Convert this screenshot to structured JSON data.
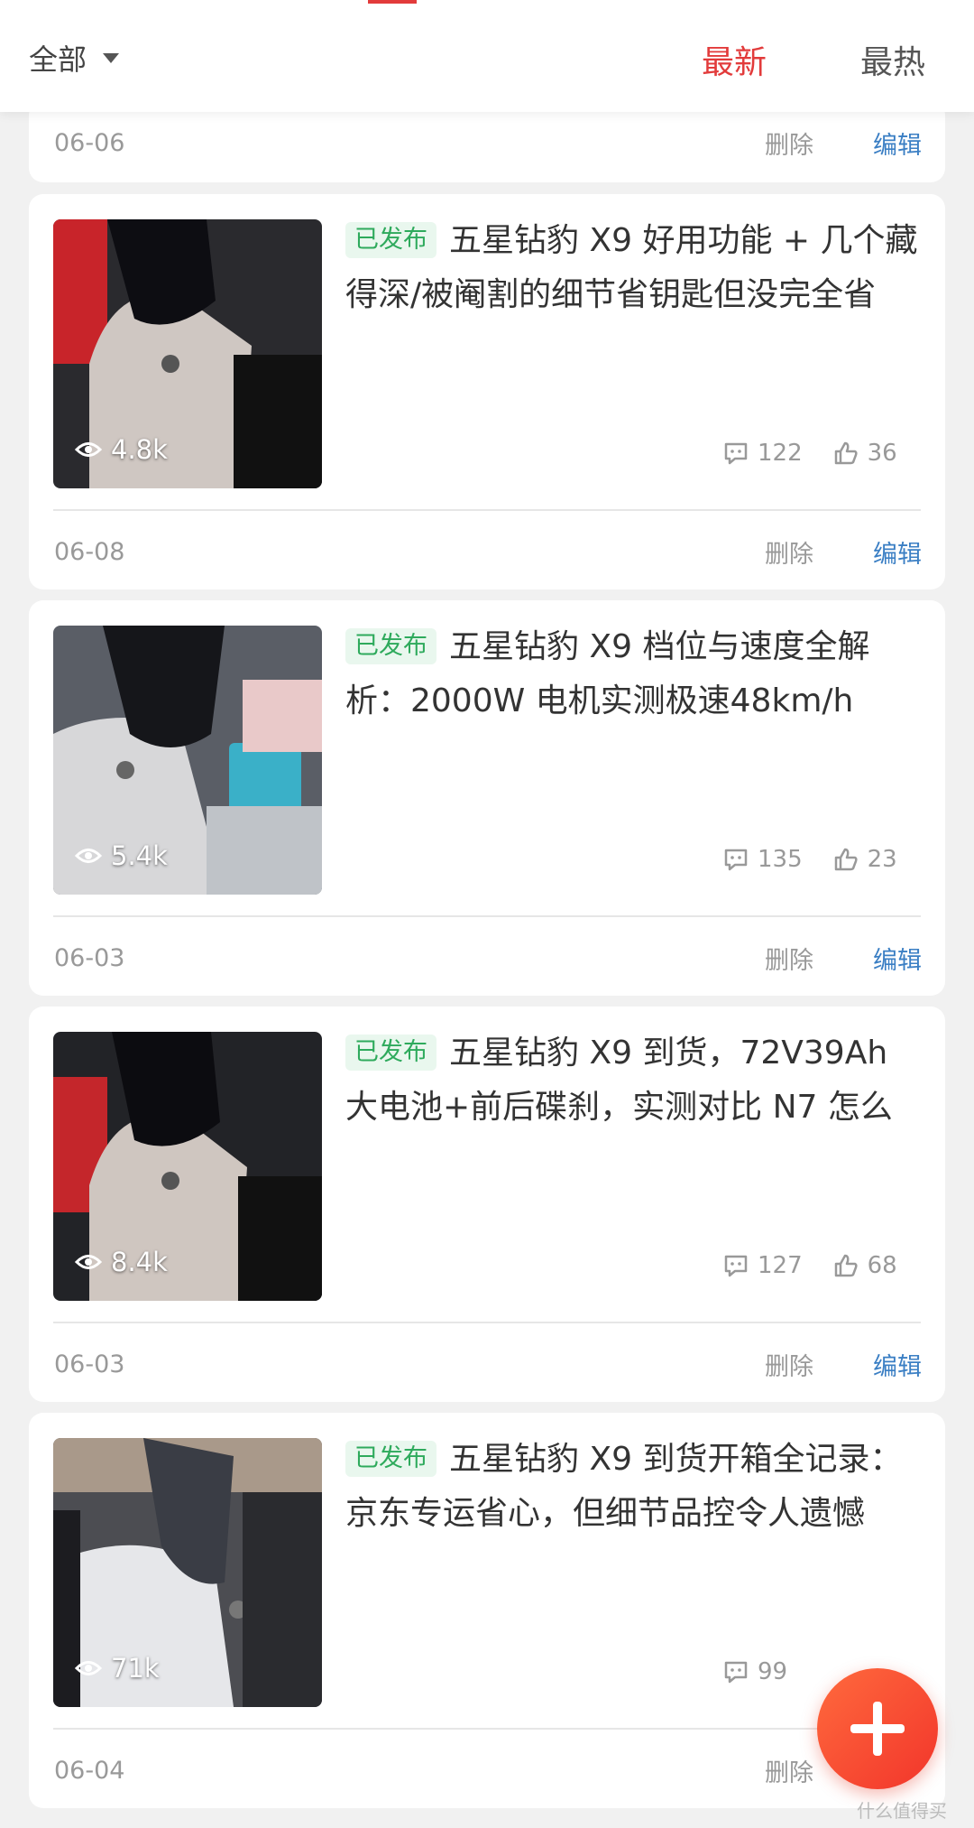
{
  "header": {
    "filter_label": "全部",
    "sort_options": [
      "最新",
      "最热"
    ],
    "active_sort": "最新"
  },
  "row_actions": {
    "delete": "删除",
    "edit": "编辑"
  },
  "top_card": {
    "date": "06-06"
  },
  "articles": [
    {
      "status": "已发布",
      "title": "五星钻豹 X9 好用功能 + 几个藏得深/被阉割的细节省钥匙但没完全省",
      "views": "4.8k",
      "comments": "122",
      "likes": "36",
      "date": "06-08"
    },
    {
      "status": "已发布",
      "title": "五星钻豹 X9 档位与速度全解析：2000W 电机实测极速48km/h",
      "views": "5.4k",
      "comments": "135",
      "likes": "23",
      "date": "06-03"
    },
    {
      "status": "已发布",
      "title": "五星钻豹 X9 到货，72V39Ah 大电池+前后碟刹，实测对比 N7 怎么",
      "views": "8.4k",
      "comments": "127",
      "likes": "68",
      "date": "06-03"
    },
    {
      "status": "已发布",
      "title": "五星钻豹 X9 到货开箱全记录：京东专运省心，但细节品控令人遗憾",
      "views": "71k",
      "comments": "99",
      "likes": "",
      "date": "06-04"
    }
  ],
  "watermark": "什么值得买",
  "icons": {
    "filter": "caret-down-icon",
    "views": "eye-icon",
    "comments": "comment-icon",
    "likes": "thumbs-up-icon",
    "fab": "plus-icon"
  },
  "colors": {
    "accent": "#e23b3b",
    "published": "#2eaa5c",
    "edit": "#3b7fc4"
  }
}
